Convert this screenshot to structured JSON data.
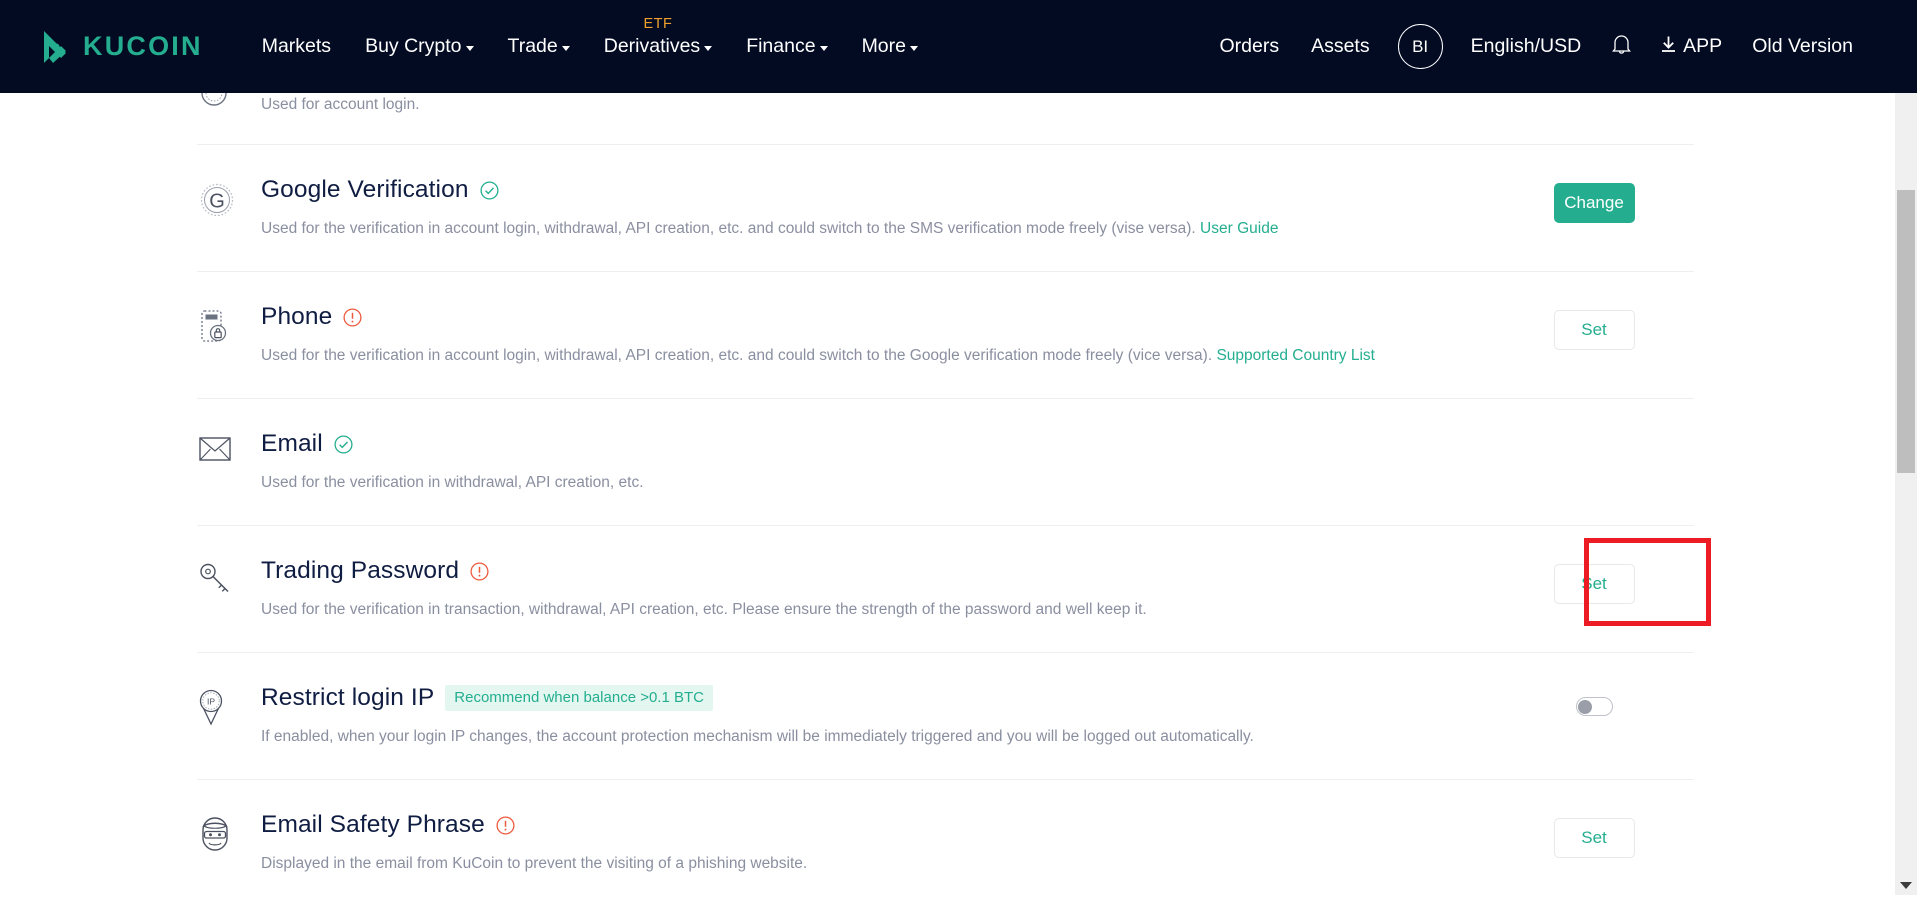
{
  "navbar": {
    "brand": "KUCOIN",
    "links": [
      {
        "label": "Markets",
        "caret": false,
        "badge": null
      },
      {
        "label": "Buy Crypto",
        "caret": true,
        "badge": null
      },
      {
        "label": "Trade",
        "caret": true,
        "badge": null
      },
      {
        "label": "Derivatives",
        "caret": true,
        "badge": "ETF"
      },
      {
        "label": "Finance",
        "caret": true,
        "badge": null
      },
      {
        "label": "More",
        "caret": true,
        "badge": null
      }
    ],
    "right": {
      "orders": "Orders",
      "assets": "Assets",
      "avatar_initials": "BI",
      "language_currency": "English/USD",
      "bell_icon": "bell-icon",
      "app_label": "APP",
      "app_icon": "download-icon",
      "old_version": "Old Version"
    }
  },
  "colors": {
    "brand_teal": "#24AE8F",
    "nav_background": "#030B23",
    "warning_red": "#ED5B3F",
    "highlight_red": "#ED1C24",
    "badge_background": "#E4F6F0",
    "title_text": "#101D42",
    "desc_text": "#8A8FA0"
  },
  "security_rows": [
    {
      "id": "login-password",
      "title": "",
      "icon": "lock-circle-icon",
      "status": "none",
      "desc_before": "Used for account login.",
      "link_text": "",
      "desc_after": "",
      "badge": "",
      "action_type": "button-filled-partial",
      "action_label": ""
    },
    {
      "id": "google-verification",
      "title": "Google Verification",
      "icon": "google-g-icon",
      "status": "verified",
      "desc_before": "Used for the verification in account login, withdrawal, API creation, etc. and could switch to the SMS verification mode freely (vise versa). ",
      "link_text": "User Guide",
      "desc_after": "",
      "badge": "",
      "action_type": "button-filled",
      "action_label": "Change"
    },
    {
      "id": "phone",
      "title": "Phone",
      "icon": "phone-lock-icon",
      "status": "warning",
      "desc_before": "Used for the verification in account login, withdrawal, API creation, etc. and could switch to the Google verification mode freely (vice versa). ",
      "link_text": "Supported Country List",
      "desc_after": "",
      "badge": "",
      "action_type": "button-outline",
      "action_label": "Set"
    },
    {
      "id": "email",
      "title": "Email",
      "icon": "envelope-icon",
      "status": "verified",
      "desc_before": "Used for the verification in withdrawal, API creation, etc.",
      "link_text": "",
      "desc_after": "",
      "badge": "",
      "action_type": "none",
      "action_label": ""
    },
    {
      "id": "trading-password",
      "title": "Trading Password",
      "icon": "key-icon",
      "status": "warning",
      "desc_before": "Used for the verification in transaction, withdrawal, API creation, etc. Please ensure the strength of the password and well keep it.",
      "link_text": "",
      "desc_after": "",
      "badge": "",
      "action_type": "button-outline",
      "action_label": "Set",
      "highlighted": true
    },
    {
      "id": "restrict-login-ip",
      "title": "Restrict login IP",
      "icon": "ip-pin-icon",
      "status": "none",
      "desc_before": "If enabled, when your login IP changes, the account protection mechanism will be immediately triggered and you will be logged out automatically.",
      "link_text": "",
      "desc_after": "",
      "badge": "Recommend when balance >0.1 BTC",
      "action_type": "toggle",
      "action_label": "",
      "toggle_on": false
    },
    {
      "id": "email-safety-phrase",
      "title": "Email Safety Phrase",
      "icon": "masked-face-icon",
      "status": "warning",
      "desc_before": "Displayed in the email from KuCoin to prevent the visiting of a phishing website.",
      "link_text": "",
      "desc_after": "",
      "badge": "",
      "action_type": "button-outline",
      "action_label": "Set"
    }
  ],
  "scrollbar": {
    "name": "vertical-scrollbar",
    "down_arrow": "chevron-down-icon"
  }
}
